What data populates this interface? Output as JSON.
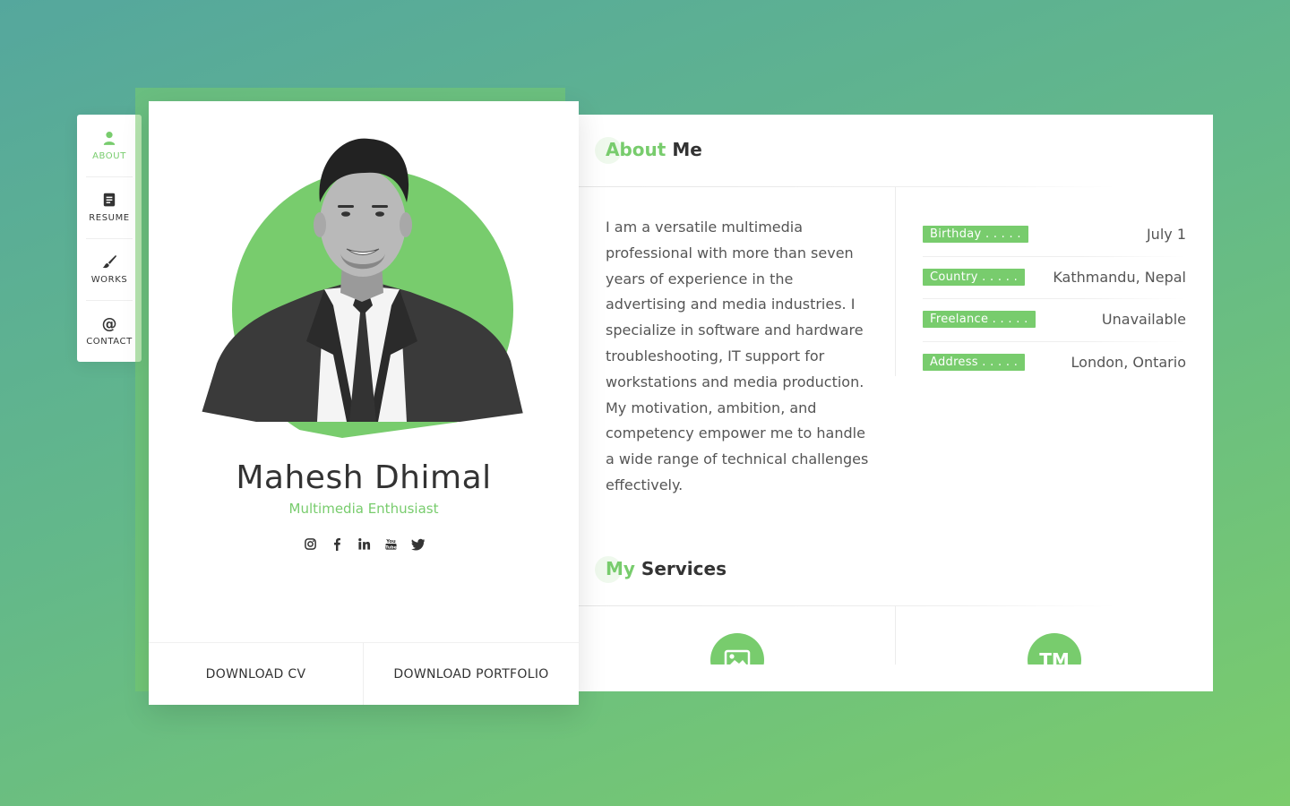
{
  "nav": {
    "items": [
      {
        "label": "ABOUT",
        "icon": "person-icon",
        "active": true
      },
      {
        "label": "RESUME",
        "icon": "document-icon",
        "active": false
      },
      {
        "label": "WORKS",
        "icon": "brush-icon",
        "active": false
      },
      {
        "label": "CONTACT",
        "icon": "at-icon",
        "active": false
      }
    ]
  },
  "profile": {
    "name": "Mahesh Dhimal",
    "title": "Multimedia Enthusiast",
    "socials": [
      "instagram-icon",
      "facebook-icon",
      "linkedin-icon",
      "youtube-icon",
      "twitter-icon"
    ],
    "download_cv": "DOWNLOAD CV",
    "download_portfolio": "DOWNLOAD PORTFOLIO"
  },
  "about": {
    "title_accent": "About",
    "title_rest": "Me",
    "text": "I am a versatile multimedia professional with more than seven years of experience in the advertising and media industries. I specialize in software and hardware troubleshooting, IT support for workstations and media production. My motivation, ambition, and competency empower me to handle a wide range of technical challenges effectively.",
    "info": [
      {
        "label": "Birthday . . . . .",
        "value": "July 1"
      },
      {
        "label": "Country . . . . .",
        "value": "Kathmandu, Nepal"
      },
      {
        "label": "Freelance . . . . .",
        "value": "Unavailable"
      },
      {
        "label": "Address . . . . .",
        "value": "London, Ontario"
      }
    ]
  },
  "services": {
    "title_accent": "My",
    "title_rest": "Services",
    "icons": [
      {
        "icon": "image-icon",
        "text": ""
      },
      {
        "icon": "trademark-icon",
        "text": "TM"
      }
    ]
  },
  "colors": {
    "accent": "#78cc6d",
    "background_start": "#55a79d",
    "background_end": "#7bcc6c"
  }
}
